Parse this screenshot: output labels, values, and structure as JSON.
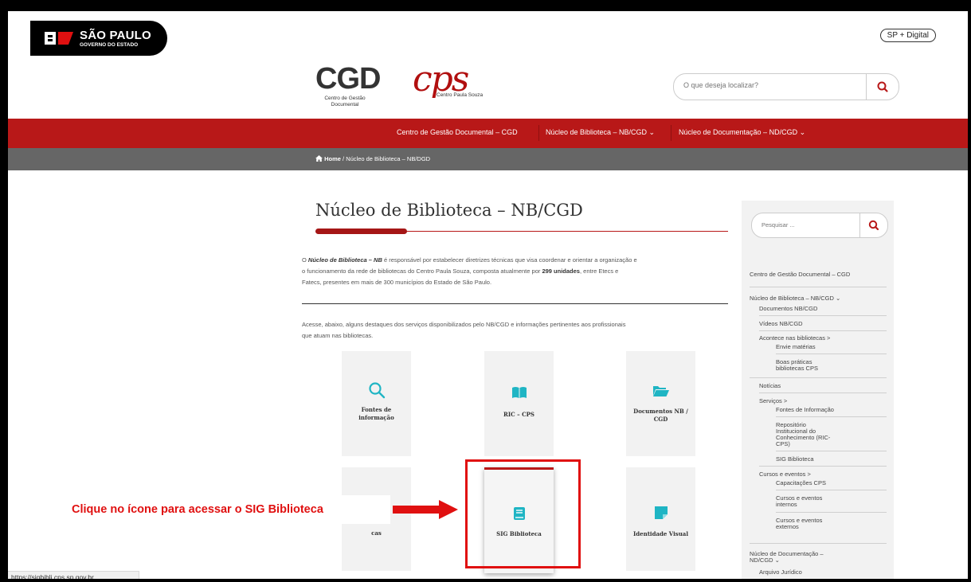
{
  "gov": {
    "logo_title": "SÃO PAULO",
    "logo_sub": "GOVERNO DO ESTADO",
    "sp_digital": "SP + Digital"
  },
  "header": {
    "cgd_title": "CGD",
    "cgd_sub": "Centro de Gestão Documental",
    "cps_title": "cps",
    "cps_sub": "Centro Paula Souza",
    "search_placeholder": "O que deseja localizar?"
  },
  "nav": {
    "items": [
      "Centro de Gestão Documental – CGD",
      "Núcleo de Biblioteca – NB/CGD ⌄",
      "Núcleo de Documentação – ND/CGD ⌄"
    ]
  },
  "breadcrumb": {
    "home": "Home",
    "current": " / Núcleo de Biblioteca – NB/DGD"
  },
  "main": {
    "title": "Núcleo de Biblioteca – NB/CGD",
    "intro_1a": "O ",
    "intro_1b": "Núcleo de Biblioteca – NB",
    "intro_1c": " é responsável por estabelecer diretrizes técnicas que visa coordenar e orientar a organização e",
    "intro_2a": "o funcionamento da rede de bibliotecas do Centro Paula Souza, composta atualmente por ",
    "intro_2b": "299 unidades",
    "intro_2c": ", entre Etecs e",
    "intro_3": "Fatecs, presentes em mais de 300 municípios do Estado de São Paulo.",
    "access_1": "Acesse, abaixo, alguns destaques dos serviços disponibilizados pelo NB/CGD e informações pertinentes aos profissionais",
    "access_2": "que atuam nas bibliotecas.",
    "cards": {
      "fontes_1": "Fontes de",
      "fontes_2": "informação",
      "ric": "RIC – CPS",
      "docs_1": "Documentos NB /",
      "docs_2": "CGD",
      "partial": "cas",
      "sig": "SIG Biblioteca",
      "identidade": "Identidade Visual"
    },
    "callout": "Clique no ícone para acessar o SIG Biblioteca"
  },
  "sidebar": {
    "search_placeholder": "Pesquisar ...",
    "cgd": "Centro de Gestão Documental – CGD",
    "nb": "Núcleo de Biblioteca – NB/CGD ⌄",
    "documentos": "Documentos NB/CGD",
    "videos": "Vídeos NB/CGD",
    "acontece": "Acontece nas bibliotecas >",
    "envie": "Envie matérias",
    "boas_1": "Boas práticas",
    "boas_2": "bibliotecas CPS",
    "noticias": "Notícias",
    "servicos": "Serviços >",
    "fontes": "Fontes de Informação",
    "repo_1": "Repositório",
    "repo_2": "Institucional do",
    "repo_3": "Conhecimento (RIC-",
    "repo_4": "CPS)",
    "sig": "SIG Biblioteca",
    "cursos": "Cursos e eventos >",
    "capacitacoes": "Capacitações CPS",
    "internos_1": "Cursos e eventos",
    "internos_2": "internos",
    "externos_1": "Cursos e eventos",
    "externos_2": "externos",
    "nd_1": "Núcleo de Documentação –",
    "nd_2": "ND/CGD ⌄",
    "arquivo": "Arquivo Jurídico"
  },
  "status_url": "https://sigbibli.cps.sp.gov.br",
  "colors": {
    "brand_red": "#b81818",
    "teal_icon": "#1fb5c4",
    "callout_red": "#e01010",
    "breadcrumb_gray": "#666666"
  }
}
